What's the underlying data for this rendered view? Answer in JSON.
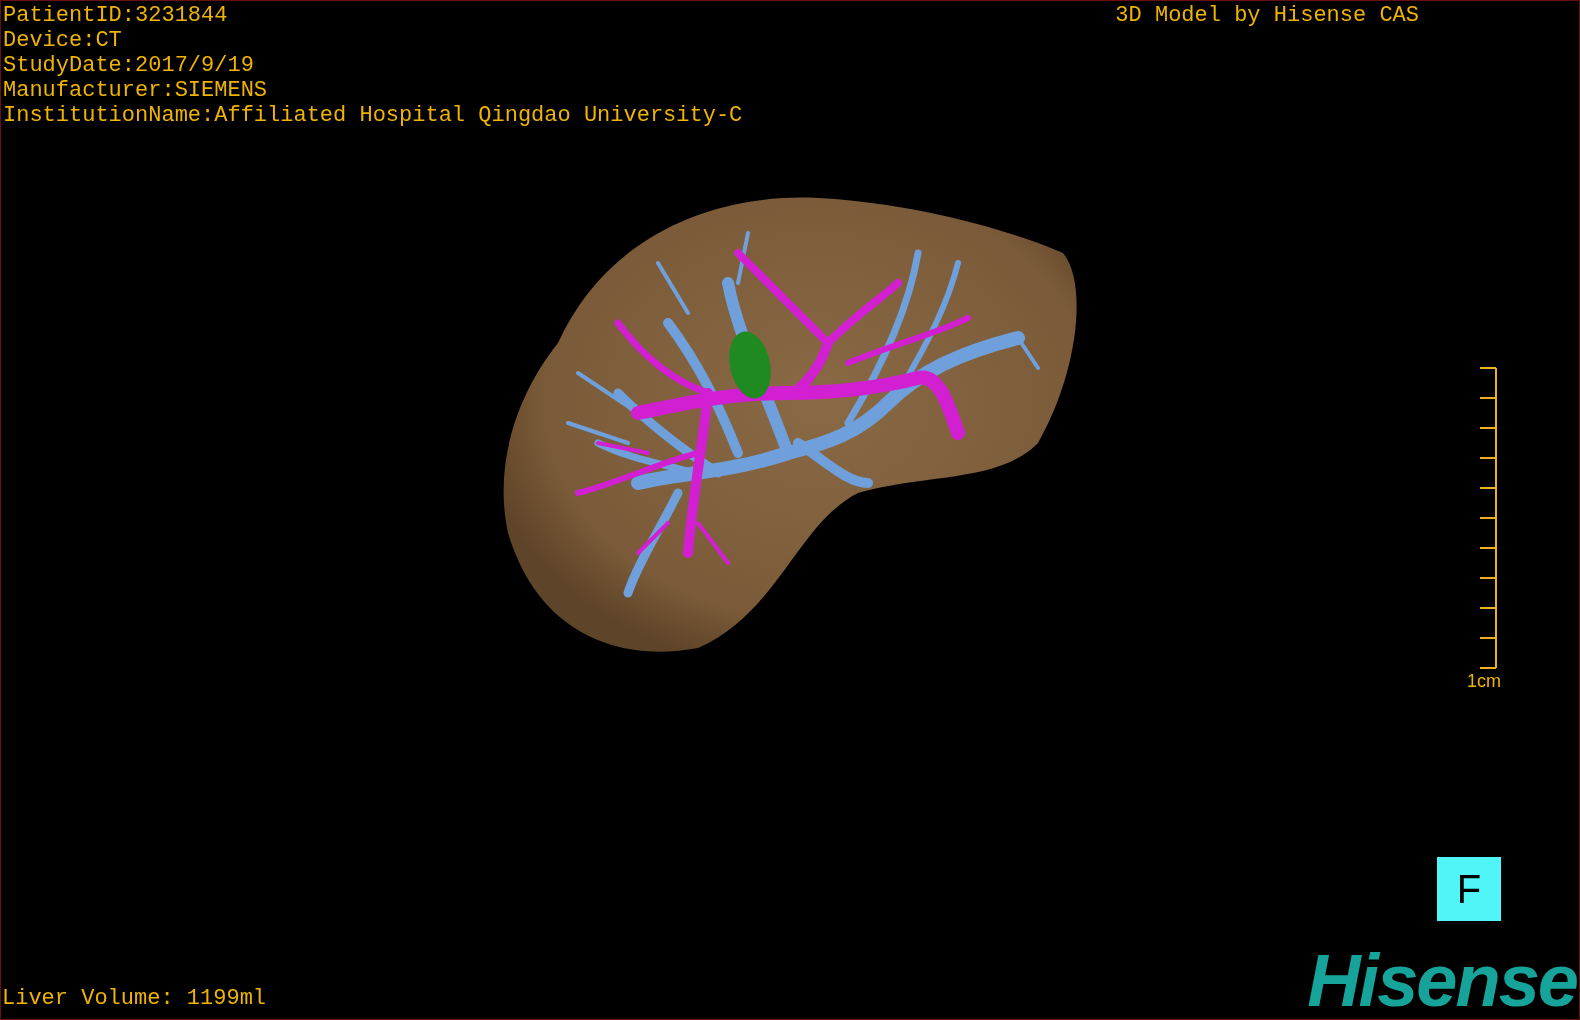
{
  "patient_info": [
    "PatientID:3231844",
    "Device:CT",
    "StudyDate:2017/9/19",
    "Manufacturer:SIEMENS",
    "InstitutionName:Affiliated Hospital Qingdao University-C"
  ],
  "title": "3D Model by Hisense CAS",
  "scale": {
    "label": "1cm"
  },
  "view_orientation": "F",
  "liver_volume": "Liver Volume: 1199ml",
  "logo": "Hisense"
}
